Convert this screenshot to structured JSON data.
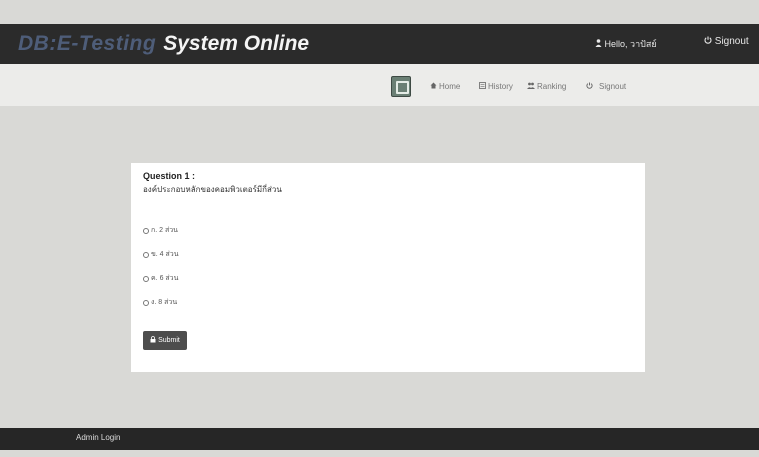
{
  "header": {
    "brand_prefix": "DB:E-Testing",
    "brand_suffix": "System Online",
    "user_greeting": "Hello, วาปัสย์",
    "signout": "Signout",
    "user_icon": "user-icon",
    "signout_icon": "power-icon"
  },
  "nav": {
    "logo_icon": "logo-icon",
    "items": [
      {
        "label": "Home",
        "icon": "home-icon"
      },
      {
        "label": "History",
        "icon": "list-icon"
      },
      {
        "label": "Ranking",
        "icon": "users-icon"
      },
      {
        "label": "Signout",
        "icon": "power-icon"
      }
    ]
  },
  "question": {
    "title": "Question 1 :",
    "text": "องค์ประกอบหลักของคอมพิวเตอร์มีกี่ส่วน",
    "options": [
      "ก. 2 ส่วน",
      "ข. 4 ส่วน",
      "ค. 6 ส่วน",
      "ง. 8 ส่วน"
    ],
    "submit": "Submit",
    "submit_icon": "lock-icon"
  },
  "footer": {
    "admin_login": "Admin Login"
  }
}
